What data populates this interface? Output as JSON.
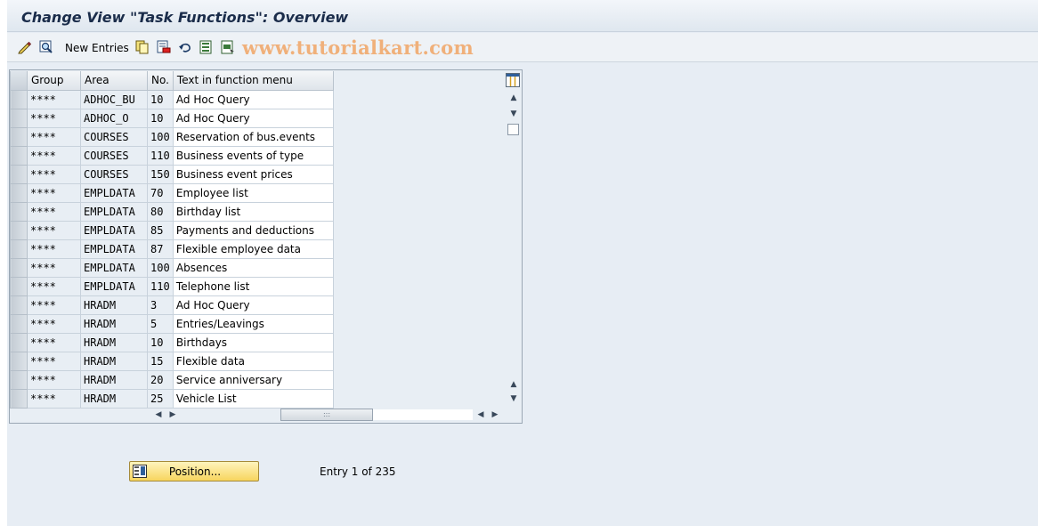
{
  "window": {
    "title": "Change View \"Task Functions\": Overview"
  },
  "toolbar": {
    "new_entries_label": "New Entries",
    "watermark": "www.tutorialkart.com",
    "icons": [
      "display-change-icon",
      "details-icon",
      "new-entries",
      "copy-as-icon",
      "delete-icon",
      "undo-change-icon",
      "select-all-icon",
      "select-block-icon"
    ]
  },
  "table": {
    "headers": {
      "group": "Group",
      "area": "Area",
      "no": "No.",
      "text": "Text in function menu"
    },
    "rows": [
      {
        "group": "****",
        "area": "ADHOC_BU",
        "no": "10",
        "text": "Ad Hoc Query"
      },
      {
        "group": "****",
        "area": "ADHOC_O",
        "no": "10",
        "text": "Ad Hoc Query"
      },
      {
        "group": "****",
        "area": "COURSES",
        "no": "100",
        "text": "Reservation of bus.events"
      },
      {
        "group": "****",
        "area": "COURSES",
        "no": "110",
        "text": "Business events of type"
      },
      {
        "group": "****",
        "area": "COURSES",
        "no": "150",
        "text": "Business event prices"
      },
      {
        "group": "****",
        "area": "EMPLDATA",
        "no": "70",
        "text": "Employee list"
      },
      {
        "group": "****",
        "area": "EMPLDATA",
        "no": "80",
        "text": "Birthday list"
      },
      {
        "group": "****",
        "area": "EMPLDATA",
        "no": "85",
        "text": "Payments and deductions"
      },
      {
        "group": "****",
        "area": "EMPLDATA",
        "no": "87",
        "text": "Flexible employee data"
      },
      {
        "group": "****",
        "area": "EMPLDATA",
        "no": "100",
        "text": "Absences"
      },
      {
        "group": "****",
        "area": "EMPLDATA",
        "no": "110",
        "text": "Telephone list"
      },
      {
        "group": "****",
        "area": "HRADM",
        "no": "3",
        "text": "Ad Hoc Query"
      },
      {
        "group": "****",
        "area": "HRADM",
        "no": "5",
        "text": "Entries/Leavings"
      },
      {
        "group": "****",
        "area": "HRADM",
        "no": "10",
        "text": "Birthdays"
      },
      {
        "group": "****",
        "area": "HRADM",
        "no": "15",
        "text": "Flexible data"
      },
      {
        "group": "****",
        "area": "HRADM",
        "no": "20",
        "text": "Service anniversary"
      },
      {
        "group": "****",
        "area": "HRADM",
        "no": "25",
        "text": "Vehicle List"
      }
    ]
  },
  "footer": {
    "position_button": "Position...",
    "entry_info": "Entry 1 of 235"
  },
  "colors": {
    "background": "#e7edf4",
    "title_text": "#1a2c4a",
    "button_yellow": "#f7d55e",
    "watermark": "#f0b07a"
  }
}
